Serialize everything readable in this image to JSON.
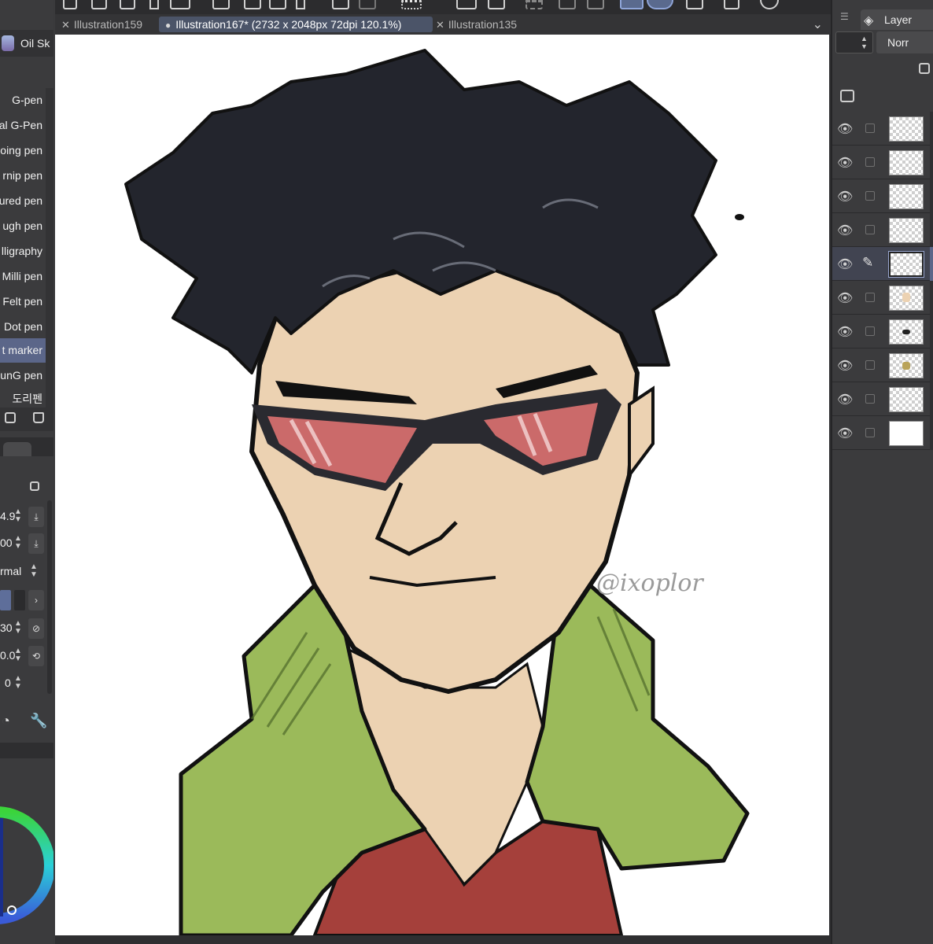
{
  "tabs": [
    {
      "label": "Illustration159",
      "active": false
    },
    {
      "label": "Illustration167* (2732 x 2048px 72dpi 120.1%)",
      "active": true
    },
    {
      "label": "Illustration135",
      "active": false
    }
  ],
  "brush_panel": {
    "header": "Oil Sk",
    "brushes": [
      "G-pen",
      "al G-Pen",
      "oing pen",
      "rnip pen",
      "ured pen",
      "ugh pen",
      "lligraphy",
      "Milli pen",
      "Felt pen",
      "Dot pen",
      "t marker",
      "unG pen",
      "도리펜"
    ],
    "selected_index": 10
  },
  "tool_properties": [
    {
      "value": "4.9"
    },
    {
      "value": "00"
    },
    {
      "value": "rmal"
    },
    {
      "value": "30"
    },
    {
      "value": "0.0"
    },
    {
      "value": "0"
    }
  ],
  "layer_panel": {
    "title": "Layer",
    "blend_mode": "Norr",
    "layer_count": 10,
    "selected_index": 4
  },
  "artwork": {
    "signature": "@ixoplor",
    "colors": {
      "skin": "#ecd2b2",
      "hair": "#23252d",
      "jacket": "#9bba5a",
      "shirt": "#a5403b",
      "lens": "#cb6a6a"
    }
  }
}
